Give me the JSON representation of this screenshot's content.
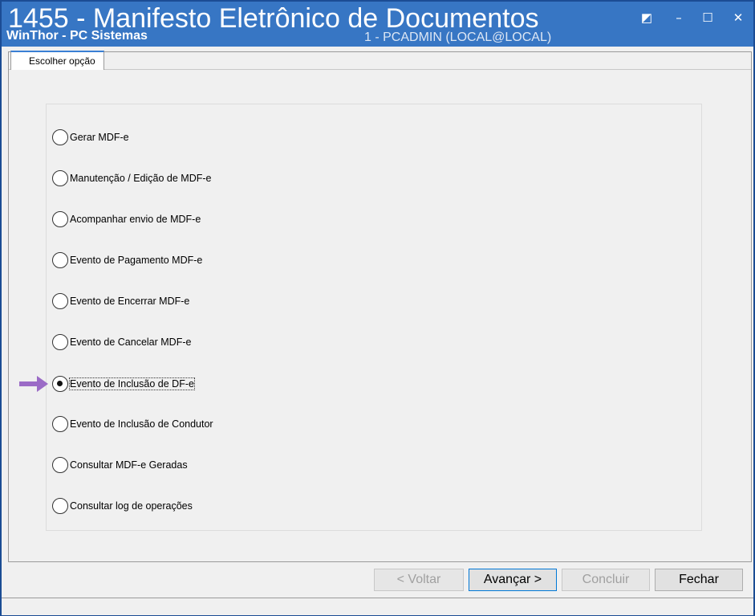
{
  "window": {
    "title": "1455 - Manifesto Eletrônico de Documentos",
    "app_name": "WinThor - PC Sistemas",
    "user_info": "1 - PCADMIN (LOCAL@LOCAL)",
    "controls": {
      "restore_icon": "◩",
      "minimize_icon": "–",
      "maximize_icon": "☐",
      "close_icon": "✕"
    }
  },
  "tab": {
    "label": "Escolher opção"
  },
  "options": [
    {
      "label": "Gerar MDF-e",
      "selected": false
    },
    {
      "label": "Manutenção / Edição de MDF-e",
      "selected": false
    },
    {
      "label": "Acompanhar envio de MDF-e",
      "selected": false
    },
    {
      "label": "Evento de Pagamento MDF-e",
      "selected": false
    },
    {
      "label": "Evento de Encerrar MDF-e",
      "selected": false
    },
    {
      "label": "Evento de Cancelar MDF-e",
      "selected": false
    },
    {
      "label": "Evento de Inclusão de DF-e",
      "selected": true
    },
    {
      "label": "Evento de Inclusão de Condutor",
      "selected": false
    },
    {
      "label": "Consultar MDF-e Geradas",
      "selected": false
    },
    {
      "label": "Consultar log de operações",
      "selected": false
    }
  ],
  "buttons": {
    "back_label": "< Voltar",
    "next_label": "Avançar >",
    "finish_label": "Concluir",
    "close_label": "Fechar"
  },
  "colors": {
    "titlebar": "#3776c4",
    "arrow": "#9b6bc6",
    "tab_accent": "#3a7fd4"
  }
}
